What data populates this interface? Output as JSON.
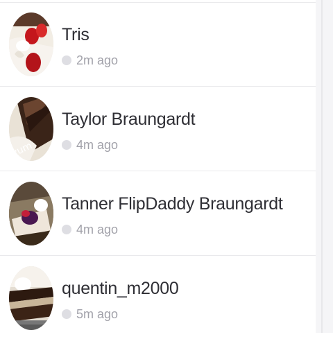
{
  "conversations": [
    {
      "name": "Tris",
      "time": "2m ago",
      "avatar_icon": "dessert-strawberry-photo"
    },
    {
      "name": "Taylor Braungardt",
      "time": "4m ago",
      "avatar_icon": "chocolate-cake-photo"
    },
    {
      "name": "Tanner FlipDaddy Braungardt",
      "time": "4m ago",
      "avatar_icon": "berry-cheesecake-photo"
    },
    {
      "name": "quentin_m2000",
      "time": "5m ago",
      "avatar_icon": "layer-cake-photo"
    }
  ],
  "colors": {
    "name_text": "#2f2f35",
    "time_text": "#a2a2aa",
    "status_dot": "#dedee3",
    "divider": "#e9e9ec"
  }
}
